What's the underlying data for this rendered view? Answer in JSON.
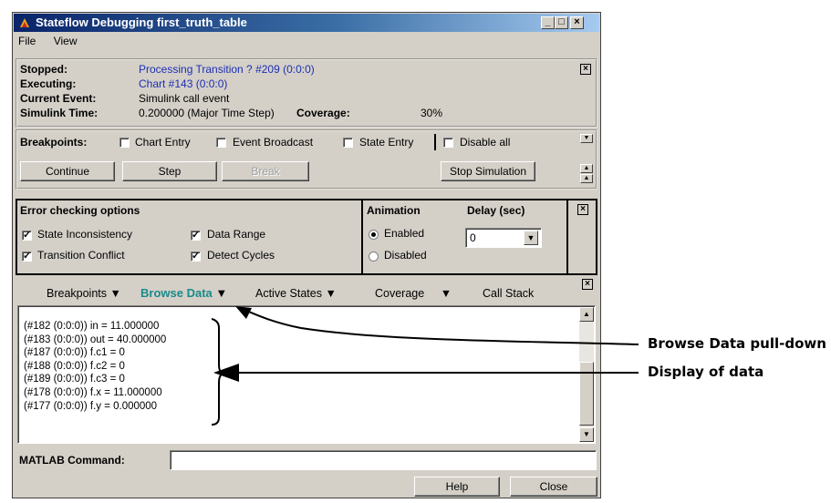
{
  "window": {
    "title": "Stateflow Debugging first_truth_table",
    "menu": [
      "File",
      "View"
    ]
  },
  "status": {
    "stopped_label": "Stopped:",
    "stopped_value": "Processing  Transition ? #209 (0:0:0)",
    "executing_label": "Executing:",
    "executing_value": "Chart #143 (0:0:0)",
    "event_label": "Current Event:",
    "event_value": "Simulink call event",
    "time_label": "Simulink Time:",
    "time_value": "0.200000 (Major Time Step)",
    "coverage_label": "Coverage:",
    "coverage_value": "30%"
  },
  "breakpoints": {
    "label": "Breakpoints:",
    "chart_entry": "Chart Entry",
    "event_broadcast": "Event Broadcast",
    "state_entry": "State Entry",
    "disable_all": "Disable all"
  },
  "controls": {
    "continue": "Continue",
    "step": "Step",
    "break": "Break",
    "stop": "Stop Simulation"
  },
  "error_checking": {
    "title": "Error checking options",
    "state_inconsistency": "State Inconsistency",
    "data_range": "Data Range",
    "transition_conflict": "Transition Conflict",
    "detect_cycles": "Detect Cycles"
  },
  "animation": {
    "title": "Animation",
    "enabled": "Enabled",
    "disabled": "Disabled",
    "selected": "Enabled",
    "delay_label": "Delay (sec)",
    "delay_value": "0"
  },
  "tabs": {
    "breakpoints": "Breakpoints",
    "browse_data": "Browse Data",
    "active_states": "Active States",
    "coverage": "Coverage",
    "call_stack": "Call Stack",
    "active_color": "#1a8a8a"
  },
  "data_lines": [
    "(#182 (0:0:0)) in = 11.000000",
    "(#183 (0:0:0)) out = 40.000000",
    "(#187 (0:0:0)) f.c1 = 0",
    "(#188 (0:0:0)) f.c2 = 0",
    "(#189 (0:0:0)) f.c3 = 0",
    "(#178 (0:0:0)) f.x = 11.000000",
    "(#177 (0:0:0)) f.y = 0.000000"
  ],
  "command": {
    "label": "MATLAB Command:",
    "value": ""
  },
  "footer": {
    "help": "Help",
    "close": "Close"
  },
  "annotations": {
    "browse_data_pulldown": "Browse Data pull-down",
    "display_of_data": "Display of data"
  }
}
